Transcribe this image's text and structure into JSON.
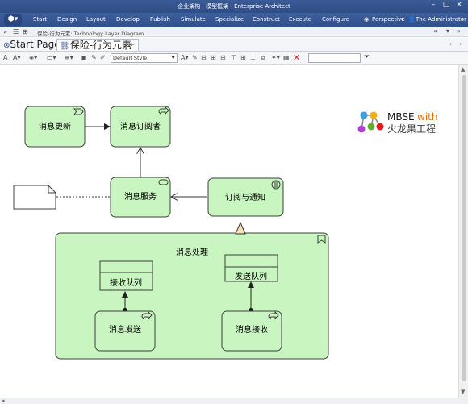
{
  "window": {
    "title": "企业架构 - 模型框架 - Enterprise Architect",
    "controls": [
      "–",
      "□",
      "×"
    ]
  },
  "ribbon": {
    "tabs": [
      "Start",
      "Design",
      "Layout",
      "Develop",
      "Publish",
      "Simulate",
      "Specialize",
      "Construct",
      "Execute",
      "Configure"
    ],
    "perspective_label": "Perspective",
    "user_label": "The Administrator"
  },
  "breadcrumb": {
    "path": "保险-行为元素:  Technology Layer Diagram"
  },
  "doc_tabs": {
    "start_page": "Start Page",
    "active_diagram": "保险-行为元素"
  },
  "toolbar": {
    "style_value": "Default Style"
  },
  "logo": {
    "line1_a": "MBSE",
    "line1_b": "with",
    "line2": "火龙果工程"
  },
  "diagram": {
    "elements": {
      "msg_update": "消息更新",
      "msg_subscriber": "消息订阅者",
      "msg_service": "消息服务",
      "subscribe_notify": "订阅与通知",
      "msg_processing": "消息处理",
      "recv_queue": "接收队列",
      "send_queue": "发送队列",
      "msg_send": "消息发送",
      "msg_recv": "消息接收"
    }
  },
  "colors": {
    "element_fill": "#c8f5c0",
    "element_stroke": "#404040",
    "logo_mbse": "#1a1a1a",
    "logo_with": "#e07010"
  }
}
